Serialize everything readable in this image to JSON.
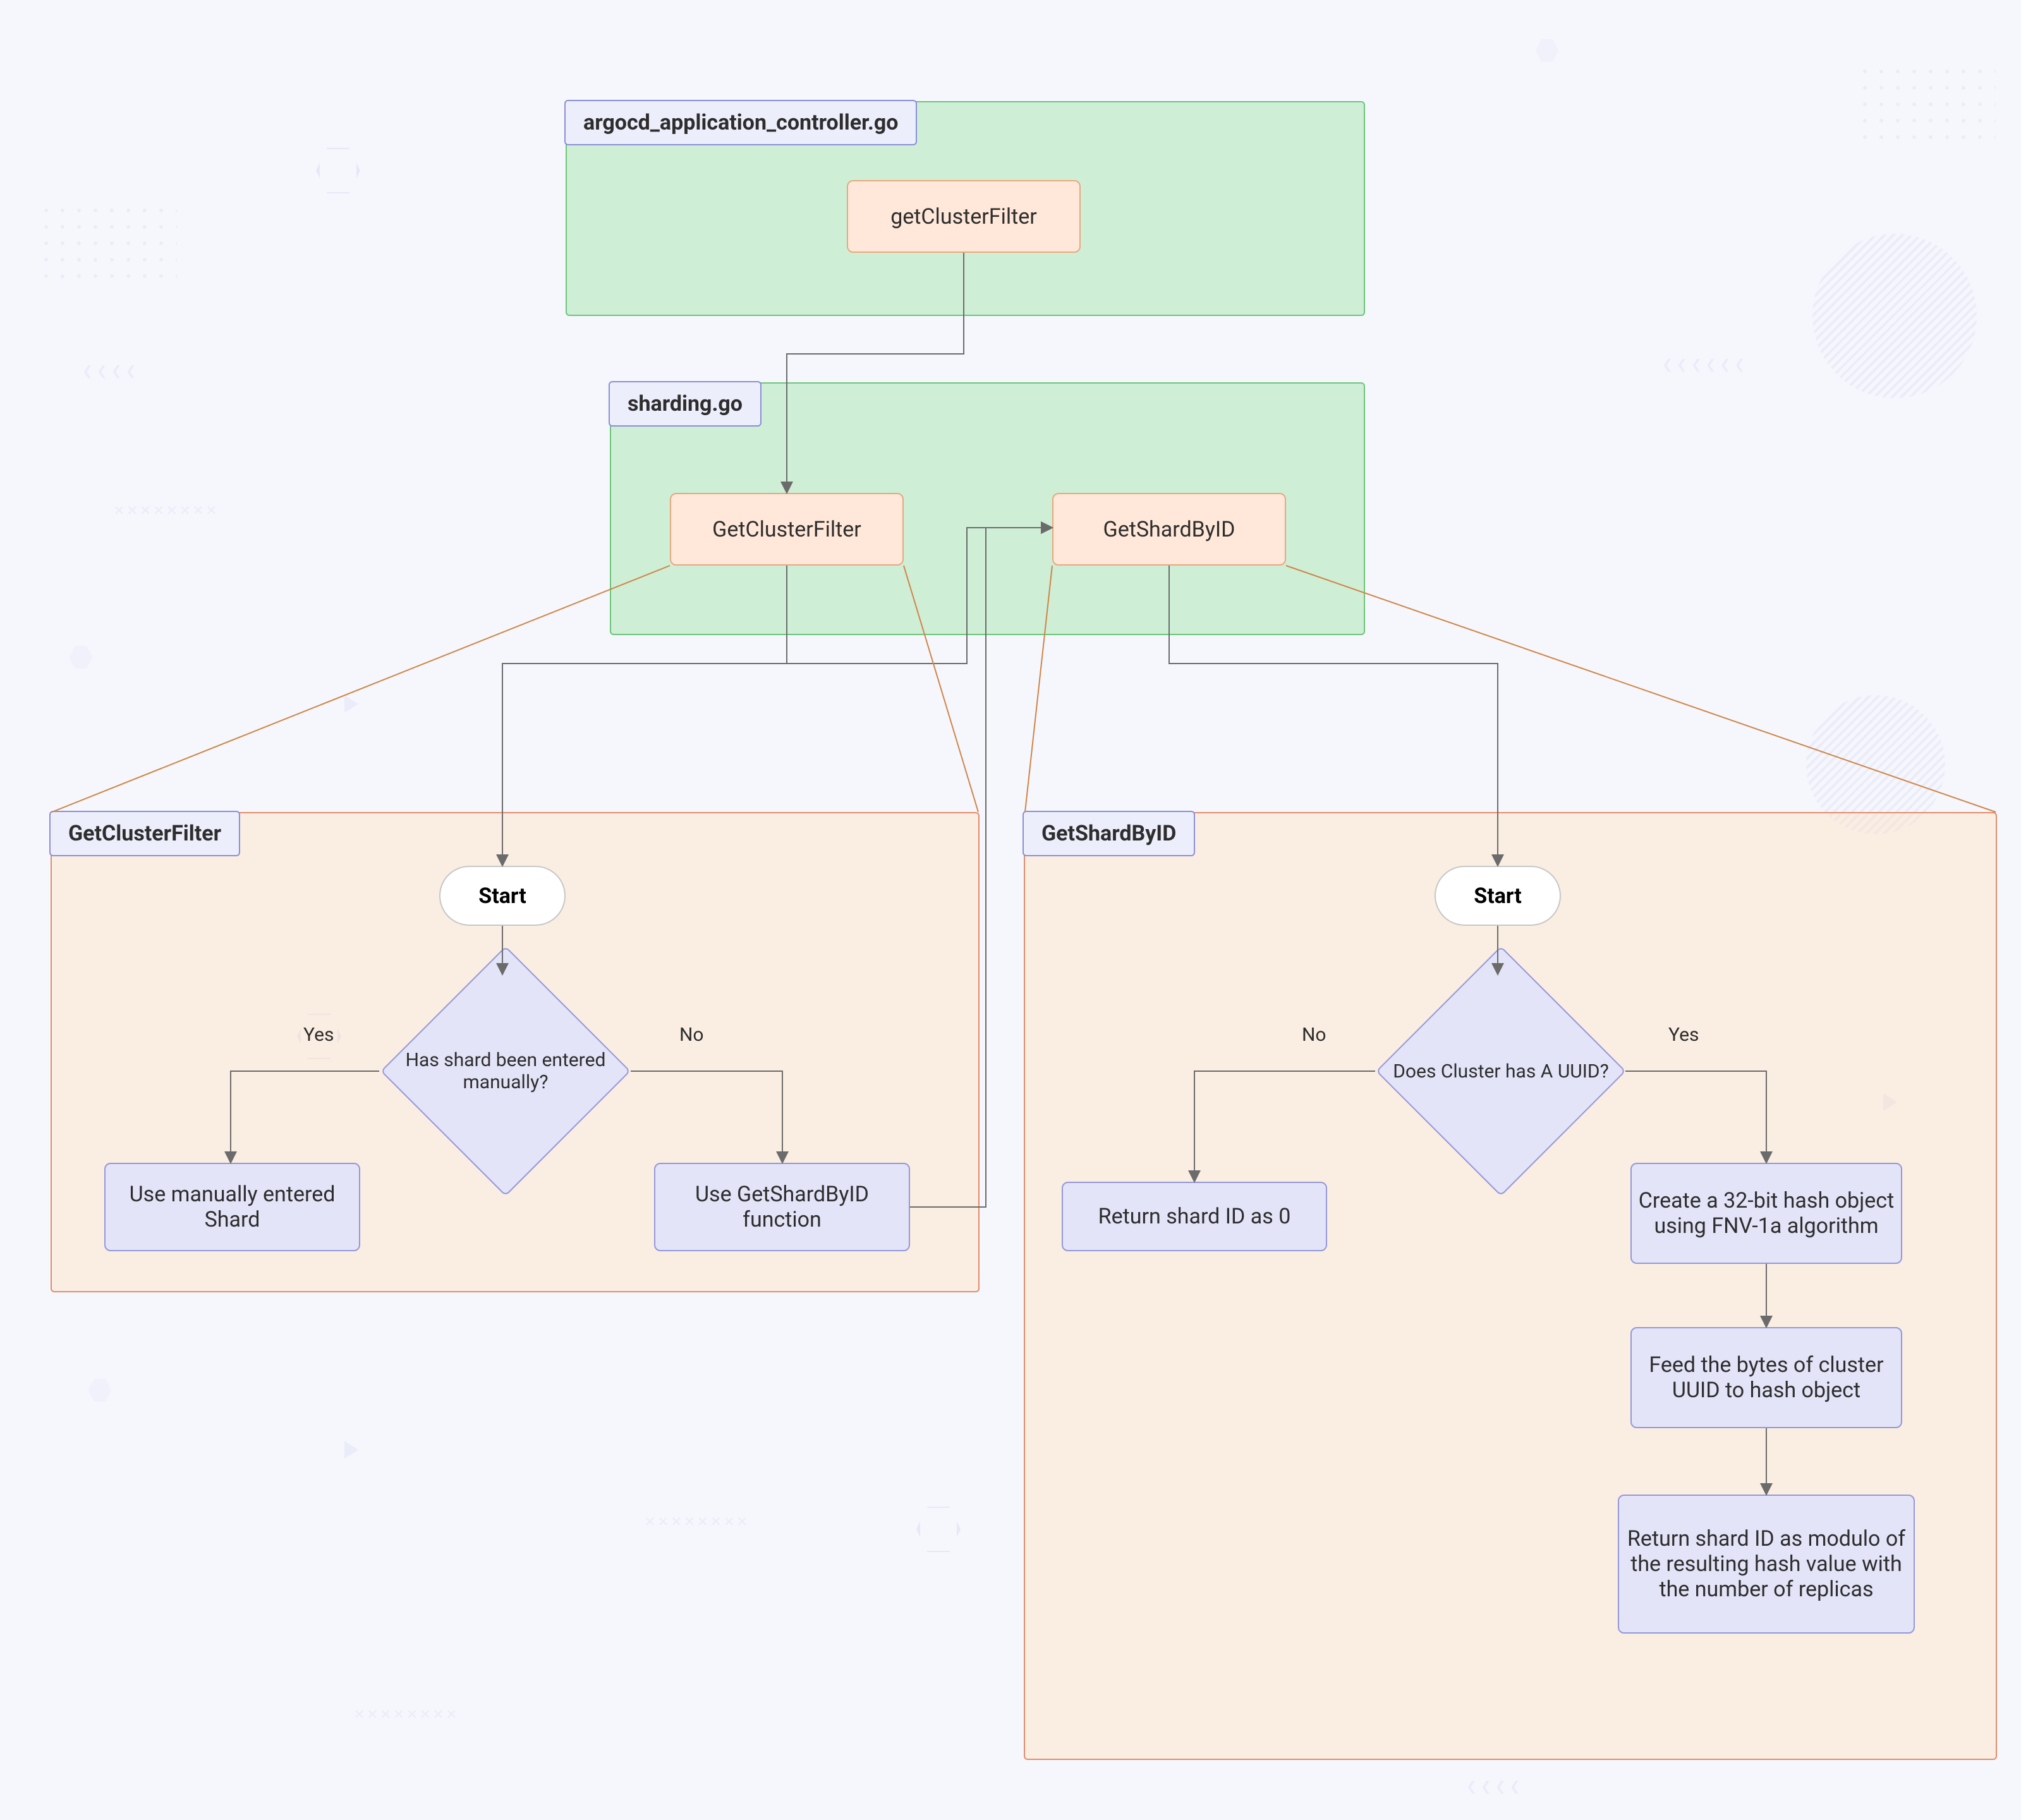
{
  "groups": {
    "top1": {
      "tag": "argocd_application_controller.go"
    },
    "top2": {
      "tag": "sharding.go"
    },
    "left": {
      "tag": "GetClusterFilter"
    },
    "right": {
      "tag": "GetShardByID"
    }
  },
  "nodes": {
    "getClusterFilterTop": "getClusterFilter",
    "GetClusterFilter": "GetClusterFilter",
    "GetShardByID": "GetShardByID",
    "startL": "Start",
    "startR": "Start",
    "decisionL": "Has shard been entered manually?",
    "decisionR": "Does Cluster has A UUID?",
    "useManual": "Use manually entered Shard",
    "useFunc": "Use GetShardByID function",
    "ret0": "Return shard ID as 0",
    "hash1": "Create a 32-bit hash object using FNV-1a algorithm",
    "hash2": "Feed the bytes of cluster UUID to hash object",
    "hash3": "Return shard ID as modulo of the resulting hash value with the number of replicas"
  },
  "labels": {
    "yesL": "Yes",
    "noL": "No",
    "yesR": "Yes",
    "noR": "No"
  }
}
